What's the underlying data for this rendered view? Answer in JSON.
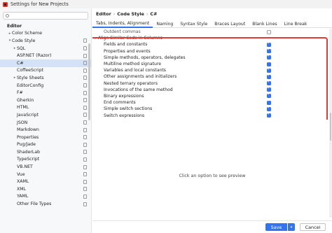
{
  "window": {
    "title": "Settings for New Projects"
  },
  "sidebar": {
    "search_placeholder": "",
    "items": [
      {
        "label": "Editor",
        "level": 0,
        "arrow": "",
        "group": true,
        "proj": false,
        "selected": false
      },
      {
        "label": "Color Scheme",
        "level": 1,
        "arrow": "▸",
        "group": false,
        "proj": false,
        "selected": false
      },
      {
        "label": "Code Style",
        "level": 1,
        "arrow": "▾",
        "group": false,
        "proj": true,
        "selected": false
      },
      {
        "label": "SQL",
        "level": 2,
        "arrow": "▸",
        "group": false,
        "proj": true,
        "selected": false
      },
      {
        "label": "ASP.NET (Razor)",
        "level": 2,
        "arrow": "",
        "group": false,
        "proj": true,
        "selected": false
      },
      {
        "label": "C#",
        "level": 2,
        "arrow": "",
        "group": false,
        "proj": true,
        "selected": true
      },
      {
        "label": "CoffeeScript",
        "level": 2,
        "arrow": "",
        "group": false,
        "proj": true,
        "selected": false
      },
      {
        "label": "Style Sheets",
        "level": 2,
        "arrow": "▸",
        "group": false,
        "proj": true,
        "selected": false
      },
      {
        "label": "EditorConfig",
        "level": 2,
        "arrow": "",
        "group": false,
        "proj": true,
        "selected": false
      },
      {
        "label": "F#",
        "level": 2,
        "arrow": "",
        "group": false,
        "proj": true,
        "selected": false
      },
      {
        "label": "Gherkin",
        "level": 2,
        "arrow": "",
        "group": false,
        "proj": true,
        "selected": false
      },
      {
        "label": "HTML",
        "level": 2,
        "arrow": "",
        "group": false,
        "proj": true,
        "selected": false
      },
      {
        "label": "JavaScript",
        "level": 2,
        "arrow": "",
        "group": false,
        "proj": true,
        "selected": false
      },
      {
        "label": "JSON",
        "level": 2,
        "arrow": "",
        "group": false,
        "proj": true,
        "selected": false
      },
      {
        "label": "Markdown",
        "level": 2,
        "arrow": "",
        "group": false,
        "proj": true,
        "selected": false
      },
      {
        "label": "Properties",
        "level": 2,
        "arrow": "",
        "group": false,
        "proj": true,
        "selected": false
      },
      {
        "label": "Pug/Jade",
        "level": 2,
        "arrow": "",
        "group": false,
        "proj": true,
        "selected": false
      },
      {
        "label": "ShaderLab",
        "level": 2,
        "arrow": "",
        "group": false,
        "proj": true,
        "selected": false
      },
      {
        "label": "TypeScript",
        "level": 2,
        "arrow": "",
        "group": false,
        "proj": true,
        "selected": false
      },
      {
        "label": "VB.NET",
        "level": 2,
        "arrow": "",
        "group": false,
        "proj": true,
        "selected": false
      },
      {
        "label": "Vue",
        "level": 2,
        "arrow": "",
        "group": false,
        "proj": true,
        "selected": false
      },
      {
        "label": "XAML",
        "level": 2,
        "arrow": "",
        "group": false,
        "proj": true,
        "selected": false
      },
      {
        "label": "XML",
        "level": 2,
        "arrow": "",
        "group": false,
        "proj": true,
        "selected": false
      },
      {
        "label": "YAML",
        "level": 2,
        "arrow": "",
        "group": false,
        "proj": true,
        "selected": false
      },
      {
        "label": "Other File Types",
        "level": 2,
        "arrow": "",
        "group": false,
        "proj": true,
        "selected": false
      }
    ]
  },
  "breadcrumb": {
    "part1": "Editor",
    "sep1": "›",
    "part2": "Code Style",
    "sep2": "›",
    "part3": "C#"
  },
  "tabs": [
    {
      "label": "Tabs, Indents, Alignment",
      "active": true
    },
    {
      "label": "Naming",
      "active": false
    },
    {
      "label": "Syntax Style",
      "active": false
    },
    {
      "label": "Braces Layout",
      "active": false
    },
    {
      "label": "Blank Lines",
      "active": false
    },
    {
      "label": "Line Break",
      "active": false
    }
  ],
  "options": {
    "top_item": {
      "label": "Outdent commas",
      "checked": false
    },
    "group": {
      "label": "Align Similar Code in Columns",
      "arrow": "▾"
    },
    "items": [
      {
        "label": "Fields and constants",
        "checked": true
      },
      {
        "label": "Properties and events",
        "checked": true
      },
      {
        "label": "Simple methods, operators, delegates",
        "checked": true
      },
      {
        "label": "Multiline method signature",
        "checked": true
      },
      {
        "label": "Variables and local constants",
        "checked": true
      },
      {
        "label": "Other assignments and initializers",
        "checked": true
      },
      {
        "label": "Nested ternary operators",
        "checked": true
      },
      {
        "label": "Invocations of the same method",
        "checked": true
      },
      {
        "label": "Binary expressions",
        "checked": true
      },
      {
        "label": "End comments",
        "checked": true
      },
      {
        "label": "Simple switch sections",
        "checked": true
      },
      {
        "label": "Switch expressions",
        "checked": true
      }
    ]
  },
  "preview_hint": "Click an option to see preview",
  "footer": {
    "save_label": "Save",
    "save_dropdown": "▾",
    "cancel_label": "Cancel"
  },
  "colors": {
    "accent": "#3574f0",
    "highlight": "#e03a3a",
    "selection": "#d4e2f7"
  }
}
